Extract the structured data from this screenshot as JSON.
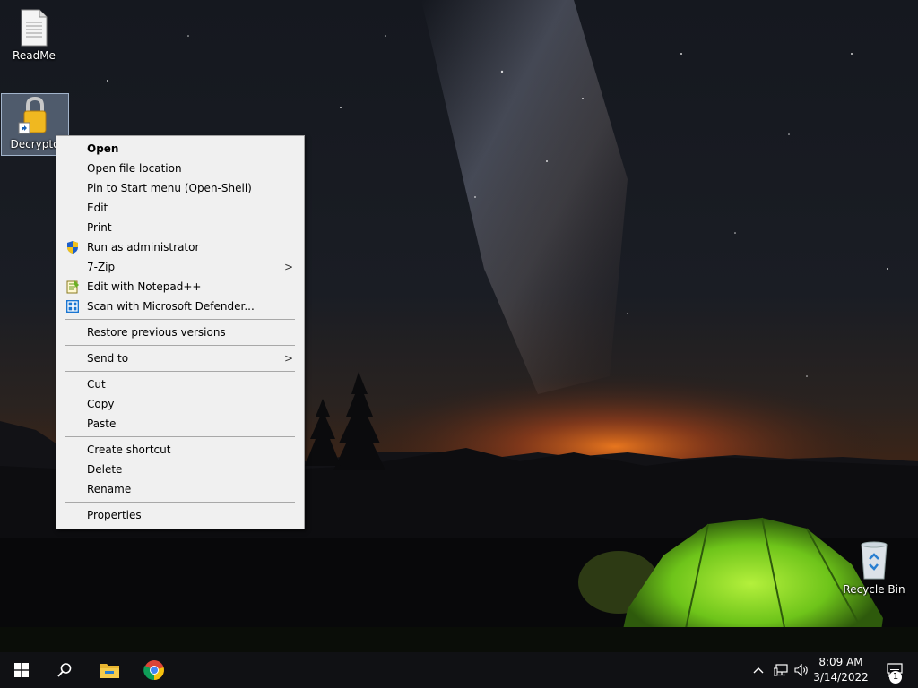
{
  "desktop": {
    "icons": [
      {
        "label": "ReadMe",
        "icon": "document-icon"
      },
      {
        "label": "Decrypto",
        "icon": "lock-icon",
        "selected": true
      },
      {
        "label": "Recycle Bin",
        "icon": "recycle-bin-icon"
      }
    ]
  },
  "context_menu": {
    "items": [
      {
        "label": "Open",
        "bold": true
      },
      {
        "label": "Open file location"
      },
      {
        "label": "Pin to Start menu (Open-Shell)"
      },
      {
        "label": "Edit"
      },
      {
        "label": "Print"
      },
      {
        "label": "Run as administrator",
        "icon": "uac-shield-icon"
      },
      {
        "label": "7-Zip",
        "submenu": true
      },
      {
        "label": "Edit with Notepad++",
        "icon": "notepadplusplus-icon"
      },
      {
        "label": "Scan with Microsoft Defender...",
        "icon": "defender-icon"
      },
      {
        "label": "Restore previous versions"
      },
      {
        "label": "Send to",
        "submenu": true
      },
      {
        "label": "Cut"
      },
      {
        "label": "Copy"
      },
      {
        "label": "Paste"
      },
      {
        "label": "Create shortcut"
      },
      {
        "label": "Delete"
      },
      {
        "label": "Rename"
      },
      {
        "label": "Properties"
      }
    ],
    "submenu_arrow": ">"
  },
  "taskbar": {
    "buttons": [
      {
        "name": "start-button",
        "icon": "windows-logo-icon"
      },
      {
        "name": "search-button",
        "icon": "search-icon"
      },
      {
        "name": "file-explorer-button",
        "icon": "folder-icon"
      },
      {
        "name": "chrome-button",
        "icon": "chrome-icon"
      }
    ],
    "tray": {
      "icons": [
        "chevron-up-icon",
        "network-icon",
        "volume-icon"
      ],
      "time": "8:09 AM",
      "date": "3/14/2022",
      "notification_count": "1"
    }
  },
  "colors": {
    "menu_bg": "#f0f0f0",
    "taskbar_bg": "#101114",
    "tent_green": "#7cd21e",
    "horizon_orange": "#e0641a"
  }
}
